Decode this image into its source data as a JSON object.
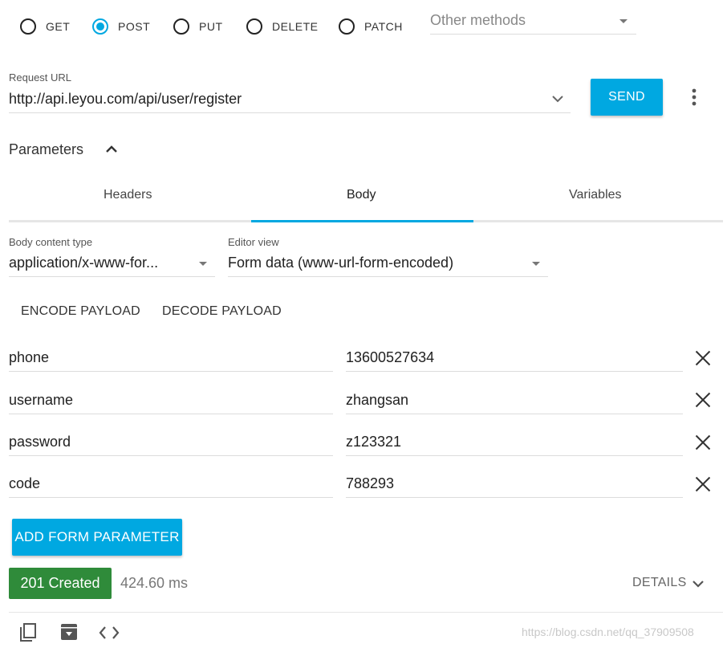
{
  "methods": [
    {
      "label": "GET",
      "checked": false
    },
    {
      "label": "POST",
      "checked": true
    },
    {
      "label": "PUT",
      "checked": false
    },
    {
      "label": "DELETE",
      "checked": false
    },
    {
      "label": "PATCH",
      "checked": false
    }
  ],
  "other_methods": {
    "placeholder": "Other methods"
  },
  "request": {
    "url_label": "Request URL",
    "url_value": "http://api.leyou.com/api/user/register",
    "send_label": "SEND"
  },
  "parameters": {
    "label": "Parameters"
  },
  "tabs": [
    {
      "label": "Headers",
      "active": false
    },
    {
      "label": "Body",
      "active": true
    },
    {
      "label": "Variables",
      "active": false
    }
  ],
  "body": {
    "content_type_label": "Body content type",
    "content_type_value": "application/x-www-for...",
    "editor_view_label": "Editor view",
    "editor_view_value": "Form data (www-url-form-encoded)",
    "encode_label": "ENCODE PAYLOAD",
    "decode_label": "DECODE PAYLOAD"
  },
  "form_params": [
    {
      "name": "phone",
      "value": "13600527634"
    },
    {
      "name": "username",
      "value": "zhangsan"
    },
    {
      "name": "password",
      "value": "z123321"
    },
    {
      "name": "code",
      "value": "788293"
    }
  ],
  "add_param_label": "ADD FORM PARAMETER",
  "response": {
    "status": "201 Created",
    "time": "424.60 ms",
    "details_label": "DETAILS"
  },
  "watermark": "https://blog.csdn.net/qq_37909508",
  "colors": {
    "accent": "#00a8e1",
    "success": "#2f8b3a"
  }
}
